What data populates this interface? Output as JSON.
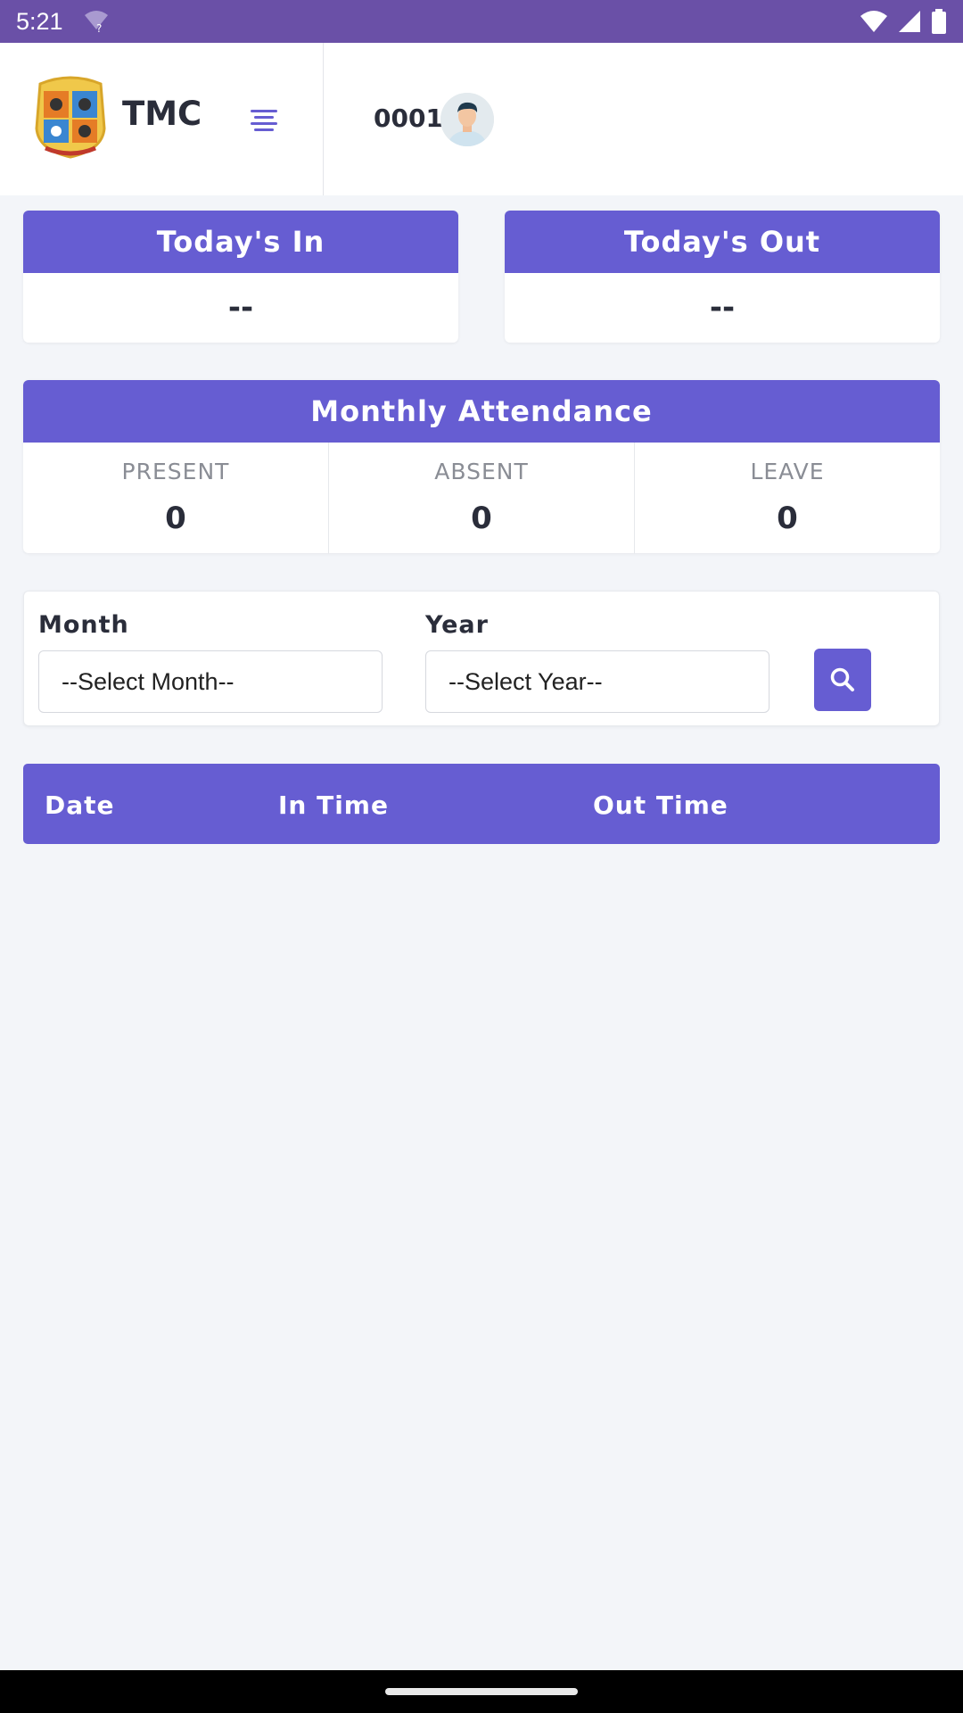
{
  "status_bar": {
    "time": "5:21",
    "qwifi_glyph": "?"
  },
  "header": {
    "brand_name": "TMC",
    "user_id": "0001",
    "accent": "#665dd2"
  },
  "today": {
    "in_title": "Today's In",
    "in_value": "--",
    "out_title": "Today's Out",
    "out_value": "--"
  },
  "monthly": {
    "title": "Monthly Attendance",
    "stats": [
      {
        "label": "PRESENT",
        "value": "0"
      },
      {
        "label": "ABSENT",
        "value": "0"
      },
      {
        "label": "LEAVE",
        "value": "0"
      }
    ]
  },
  "filter": {
    "month_label": "Month",
    "month_value": "--Select Month--",
    "year_label": "Year",
    "year_value": "--Select Year--"
  },
  "table": {
    "columns": [
      "Date",
      "In Time",
      "Out Time"
    ]
  },
  "icons": {
    "menu": "menu-icon",
    "search": "search-icon",
    "avatar": "avatar",
    "logo": "logo"
  }
}
